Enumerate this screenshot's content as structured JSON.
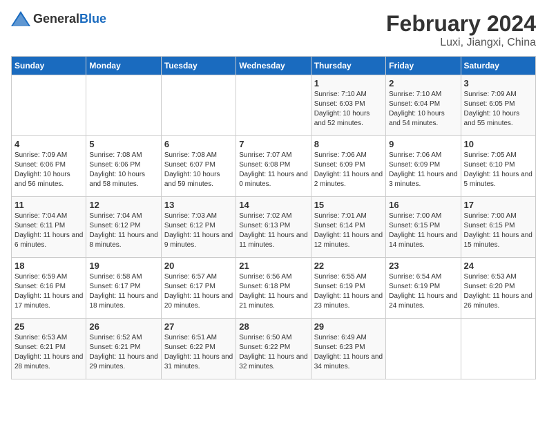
{
  "header": {
    "logo_general": "General",
    "logo_blue": "Blue",
    "month_title": "February 2024",
    "location": "Luxi, Jiangxi, China"
  },
  "days_of_week": [
    "Sunday",
    "Monday",
    "Tuesday",
    "Wednesday",
    "Thursday",
    "Friday",
    "Saturday"
  ],
  "weeks": [
    [
      {
        "day": "",
        "info": ""
      },
      {
        "day": "",
        "info": ""
      },
      {
        "day": "",
        "info": ""
      },
      {
        "day": "",
        "info": ""
      },
      {
        "day": "1",
        "info": "Sunrise: 7:10 AM\nSunset: 6:03 PM\nDaylight: 10 hours\nand 52 minutes."
      },
      {
        "day": "2",
        "info": "Sunrise: 7:10 AM\nSunset: 6:04 PM\nDaylight: 10 hours\nand 54 minutes."
      },
      {
        "day": "3",
        "info": "Sunrise: 7:09 AM\nSunset: 6:05 PM\nDaylight: 10 hours\nand 55 minutes."
      }
    ],
    [
      {
        "day": "4",
        "info": "Sunrise: 7:09 AM\nSunset: 6:06 PM\nDaylight: 10 hours\nand 56 minutes."
      },
      {
        "day": "5",
        "info": "Sunrise: 7:08 AM\nSunset: 6:06 PM\nDaylight: 10 hours\nand 58 minutes."
      },
      {
        "day": "6",
        "info": "Sunrise: 7:08 AM\nSunset: 6:07 PM\nDaylight: 10 hours\nand 59 minutes."
      },
      {
        "day": "7",
        "info": "Sunrise: 7:07 AM\nSunset: 6:08 PM\nDaylight: 11 hours\nand 0 minutes."
      },
      {
        "day": "8",
        "info": "Sunrise: 7:06 AM\nSunset: 6:09 PM\nDaylight: 11 hours\nand 2 minutes."
      },
      {
        "day": "9",
        "info": "Sunrise: 7:06 AM\nSunset: 6:09 PM\nDaylight: 11 hours\nand 3 minutes."
      },
      {
        "day": "10",
        "info": "Sunrise: 7:05 AM\nSunset: 6:10 PM\nDaylight: 11 hours\nand 5 minutes."
      }
    ],
    [
      {
        "day": "11",
        "info": "Sunrise: 7:04 AM\nSunset: 6:11 PM\nDaylight: 11 hours\nand 6 minutes."
      },
      {
        "day": "12",
        "info": "Sunrise: 7:04 AM\nSunset: 6:12 PM\nDaylight: 11 hours\nand 8 minutes."
      },
      {
        "day": "13",
        "info": "Sunrise: 7:03 AM\nSunset: 6:12 PM\nDaylight: 11 hours\nand 9 minutes."
      },
      {
        "day": "14",
        "info": "Sunrise: 7:02 AM\nSunset: 6:13 PM\nDaylight: 11 hours\nand 11 minutes."
      },
      {
        "day": "15",
        "info": "Sunrise: 7:01 AM\nSunset: 6:14 PM\nDaylight: 11 hours\nand 12 minutes."
      },
      {
        "day": "16",
        "info": "Sunrise: 7:00 AM\nSunset: 6:15 PM\nDaylight: 11 hours\nand 14 minutes."
      },
      {
        "day": "17",
        "info": "Sunrise: 7:00 AM\nSunset: 6:15 PM\nDaylight: 11 hours\nand 15 minutes."
      }
    ],
    [
      {
        "day": "18",
        "info": "Sunrise: 6:59 AM\nSunset: 6:16 PM\nDaylight: 11 hours\nand 17 minutes."
      },
      {
        "day": "19",
        "info": "Sunrise: 6:58 AM\nSunset: 6:17 PM\nDaylight: 11 hours\nand 18 minutes."
      },
      {
        "day": "20",
        "info": "Sunrise: 6:57 AM\nSunset: 6:17 PM\nDaylight: 11 hours\nand 20 minutes."
      },
      {
        "day": "21",
        "info": "Sunrise: 6:56 AM\nSunset: 6:18 PM\nDaylight: 11 hours\nand 21 minutes."
      },
      {
        "day": "22",
        "info": "Sunrise: 6:55 AM\nSunset: 6:19 PM\nDaylight: 11 hours\nand 23 minutes."
      },
      {
        "day": "23",
        "info": "Sunrise: 6:54 AM\nSunset: 6:19 PM\nDaylight: 11 hours\nand 24 minutes."
      },
      {
        "day": "24",
        "info": "Sunrise: 6:53 AM\nSunset: 6:20 PM\nDaylight: 11 hours\nand 26 minutes."
      }
    ],
    [
      {
        "day": "25",
        "info": "Sunrise: 6:53 AM\nSunset: 6:21 PM\nDaylight: 11 hours\nand 28 minutes."
      },
      {
        "day": "26",
        "info": "Sunrise: 6:52 AM\nSunset: 6:21 PM\nDaylight: 11 hours\nand 29 minutes."
      },
      {
        "day": "27",
        "info": "Sunrise: 6:51 AM\nSunset: 6:22 PM\nDaylight: 11 hours\nand 31 minutes."
      },
      {
        "day": "28",
        "info": "Sunrise: 6:50 AM\nSunset: 6:22 PM\nDaylight: 11 hours\nand 32 minutes."
      },
      {
        "day": "29",
        "info": "Sunrise: 6:49 AM\nSunset: 6:23 PM\nDaylight: 11 hours\nand 34 minutes."
      },
      {
        "day": "",
        "info": ""
      },
      {
        "day": "",
        "info": ""
      }
    ]
  ]
}
